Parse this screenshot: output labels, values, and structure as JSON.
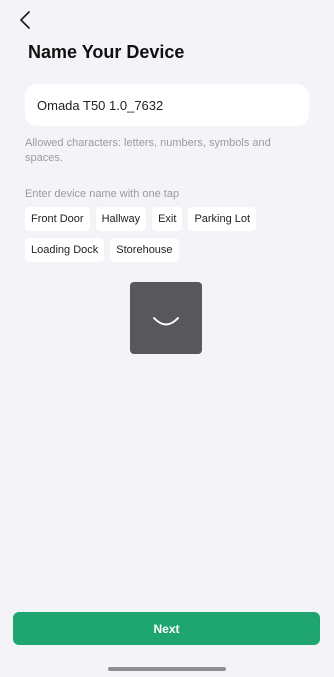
{
  "header": {
    "back_icon": "chevron-left-icon",
    "title": "Name Your Device"
  },
  "device_name": {
    "value": "Omada T50 1.0_7632",
    "placeholder": ""
  },
  "hint": "Allowed characters: letters, numbers, symbols and spaces.",
  "quick_names": {
    "label": "Enter device name with one tap",
    "row1": [
      "Front Door",
      "Hallway",
      "Exit",
      "Parking Lot"
    ],
    "row2": [
      "Loading Dock",
      "Storehouse"
    ]
  },
  "loading_indicator": {
    "icon": "spinner-arc-icon"
  },
  "footer": {
    "next_label": "Next"
  },
  "colors": {
    "background": "#f4f3f8",
    "accent": "#1fa56f",
    "loader_bg": "#58585c"
  }
}
